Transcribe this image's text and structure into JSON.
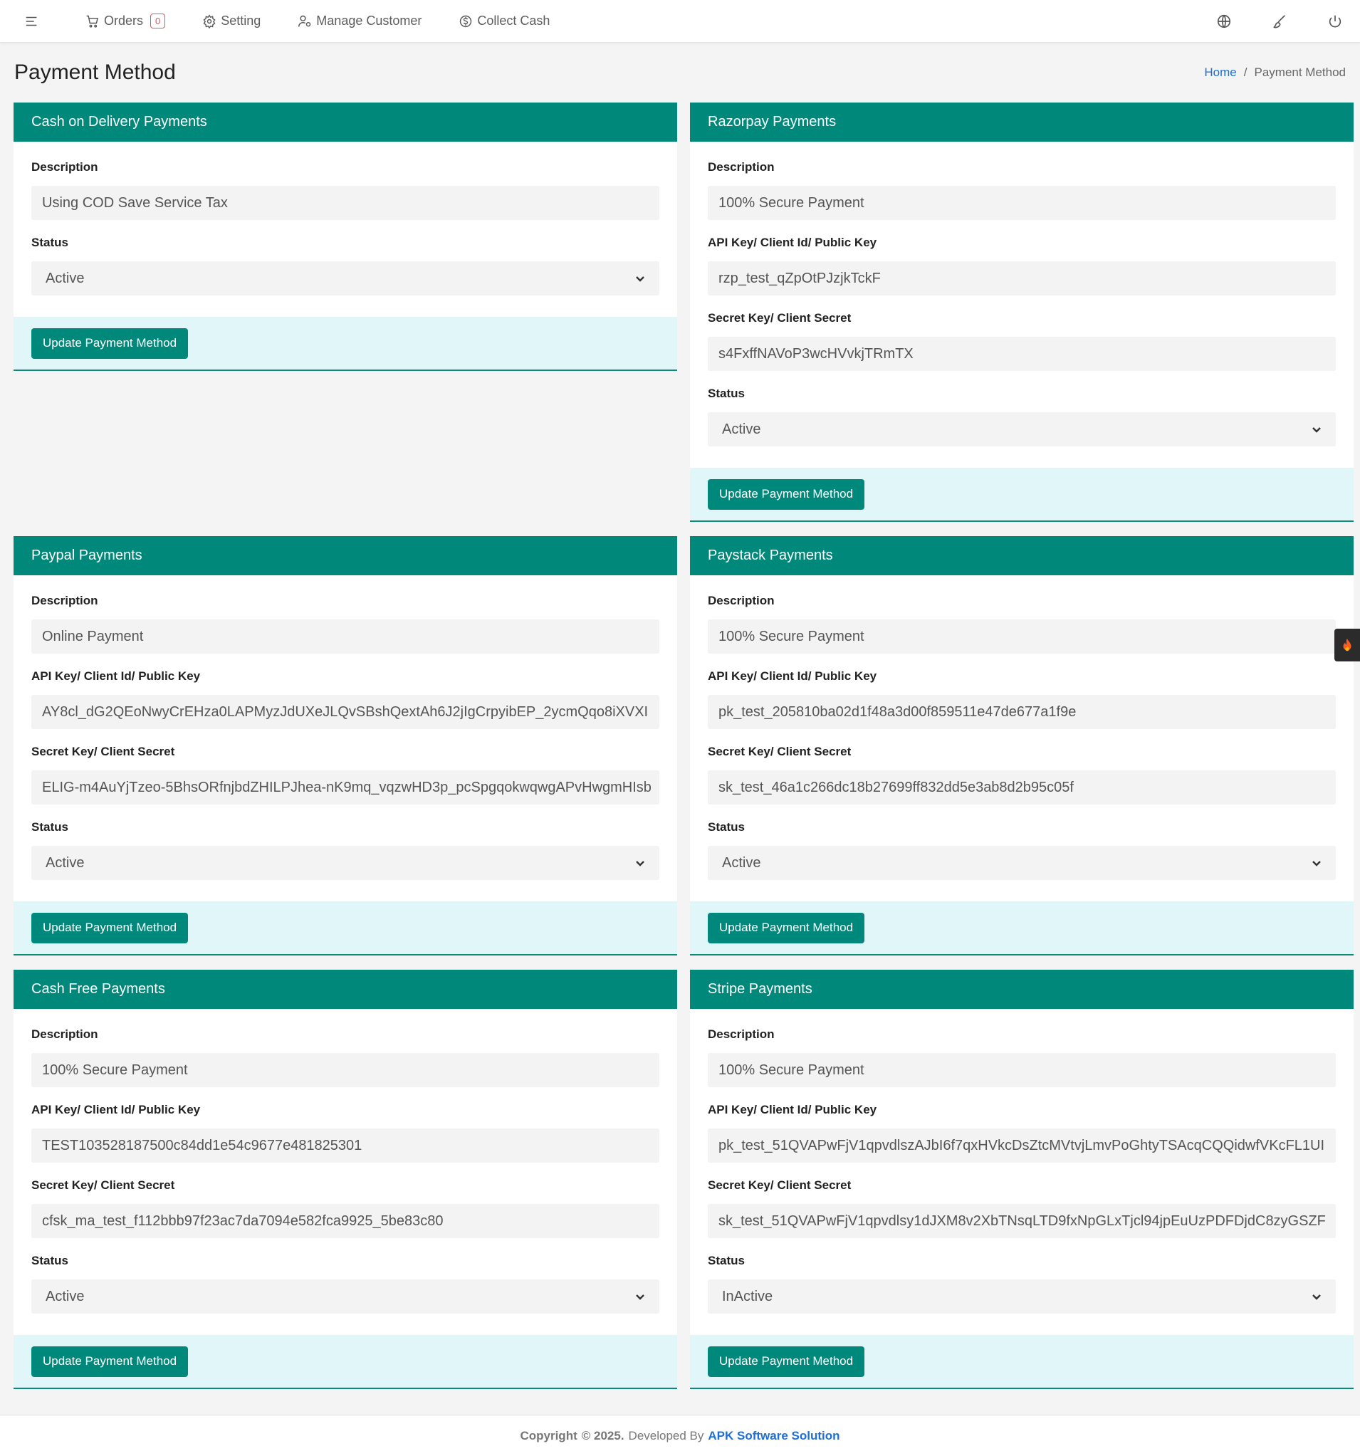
{
  "nav": {
    "orders_label": "Orders",
    "orders_count": "0",
    "setting_label": "Setting",
    "manage_customer_label": "Manage Customer",
    "collect_cash_label": "Collect Cash"
  },
  "page": {
    "title": "Payment Method",
    "breadcrumb_home": "Home",
    "breadcrumb_separator": "/",
    "breadcrumb_current": "Payment Method"
  },
  "labels": {
    "description": "Description",
    "api_key": "API Key/ Client Id/ Public Key",
    "secret_key": "Secret Key/ Client Secret",
    "status": "Status",
    "update_button": "Update Payment Method"
  },
  "cards": {
    "cod": {
      "title": "Cash on Delivery Payments",
      "description": "Using COD Save Service Tax",
      "status": "Active"
    },
    "razorpay": {
      "title": "Razorpay Payments",
      "description": "100% Secure Payment",
      "api_key": "rzp_test_qZpOtPJzjkTckF",
      "secret_key": "s4FxffNAVoP3wcHVvkjTRmTX",
      "status": "Active"
    },
    "paypal": {
      "title": "Paypal Payments",
      "description": "Online Payment",
      "api_key": "AY8cl_dG2QEoNwyCrEHza0LAPMyzJdUXeJLQvSBshQextAh6J2jIgCrpyibEP_2ycmQqo8iXVXI",
      "secret_key": "ELIG-m4AuYjTzeo-5BhsORfnjbdZHILPJhea-nK9mq_vqzwHD3p_pcSpgqokwqwgAPvHwgmHIsb",
      "status": "Active"
    },
    "paystack": {
      "title": "Paystack Payments",
      "description": "100% Secure Payment",
      "api_key": "pk_test_205810ba02d1f48a3d00f859511e47de677a1f9e",
      "secret_key": "sk_test_46a1c266dc18b27699ff832dd5e3ab8d2b95c05f",
      "status": "Active"
    },
    "cashfree": {
      "title": "Cash Free Payments",
      "description": "100% Secure Payment",
      "api_key": "TEST103528187500c84dd1e54c9677e481825301",
      "secret_key": "cfsk_ma_test_f112bbb97f23ac7da7094e582fca9925_5be83c80",
      "status": "Active"
    },
    "stripe": {
      "title": "Stripe Payments",
      "description": "100% Secure Payment",
      "api_key": "pk_test_51QVAPwFjV1qpvdlszAJbI6f7qxHVkcDsZtcMVtvjLmvPoGhtyTSAcqCQQidwfVKcFL1UI",
      "secret_key": "sk_test_51QVAPwFjV1qpvdlsy1dJXM8v2XbTNsqLTD9fxNpGLxTjcl94jpEuUzPDFDjdC8zyGSZF",
      "status": "InActive"
    }
  },
  "footer": {
    "copyright_label": "Copyright",
    "year_text": "© 2025.",
    "developed_by": "Developed By",
    "company": "APK Software Solution"
  },
  "colors": {
    "primary": "#00897b",
    "footer_band": "#e0f6f8",
    "link": "#1c6fd6",
    "badge": "#e55353"
  },
  "icons": [
    "menu-icon",
    "cart-icon",
    "gear-icon",
    "user-settings-icon",
    "cash-icon",
    "globe-icon",
    "brush-icon",
    "power-icon",
    "flame-icon",
    "chevron-down-icon"
  ]
}
